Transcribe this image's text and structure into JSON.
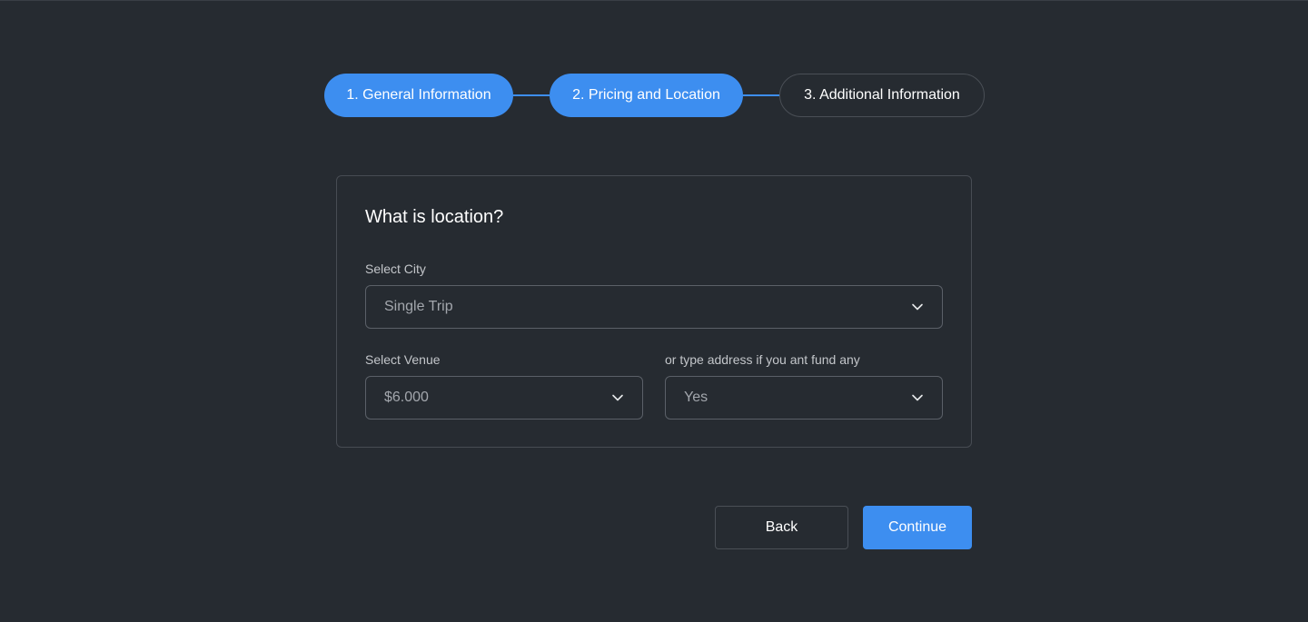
{
  "stepper": {
    "steps": [
      {
        "label": "1. General Information",
        "state": "completed"
      },
      {
        "label": "2. Pricing and Location",
        "state": "current"
      },
      {
        "label": "3. Additional Information",
        "state": "upcoming"
      }
    ],
    "active_color": "#3d8ef0"
  },
  "form": {
    "title": "What is location?",
    "city": {
      "label": "Select City",
      "value": "Single Trip",
      "icon": "chevron-down-icon"
    },
    "venue": {
      "label": "Select Venue",
      "value": "$6.000",
      "icon": "chevron-down-icon"
    },
    "address": {
      "label": "or type address if you ant fund any",
      "value": "Yes",
      "icon": "chevron-down-icon"
    }
  },
  "actions": {
    "back_label": "Back",
    "continue_label": "Continue"
  },
  "colors": {
    "background": "#262b31",
    "accent": "#3d8ef0",
    "border": "#474c53"
  }
}
